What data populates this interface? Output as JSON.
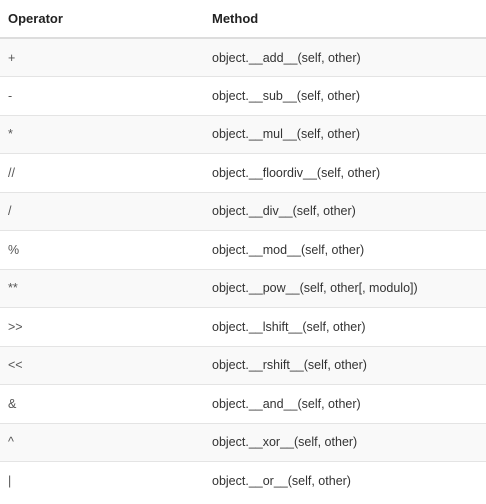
{
  "table": {
    "headers": {
      "operator": "Operator",
      "method": "Method"
    },
    "rows": [
      {
        "operator": "+",
        "method": "object.__add__(self, other)"
      },
      {
        "operator": "-",
        "method": "object.__sub__(self, other)"
      },
      {
        "operator": "*",
        "method": "object.__mul__(self, other)"
      },
      {
        "operator": "//",
        "method": "object.__floordiv__(self, other)"
      },
      {
        "operator": "/",
        "method": "object.__div__(self, other)"
      },
      {
        "operator": "%",
        "method": "object.__mod__(self, other)"
      },
      {
        "operator": "**",
        "method": "object.__pow__(self, other[, modulo])"
      },
      {
        "operator": ">>",
        "method": "object.__lshift__(self, other)"
      },
      {
        "operator": "<<",
        "method": "object.__rshift__(self, other)"
      },
      {
        "operator": "&",
        "method": "object.__and__(self, other)"
      },
      {
        "operator": "^",
        "method": "object.__xor__(self, other)"
      },
      {
        "operator": "|",
        "method": "object.__or__(self, other)"
      }
    ]
  }
}
